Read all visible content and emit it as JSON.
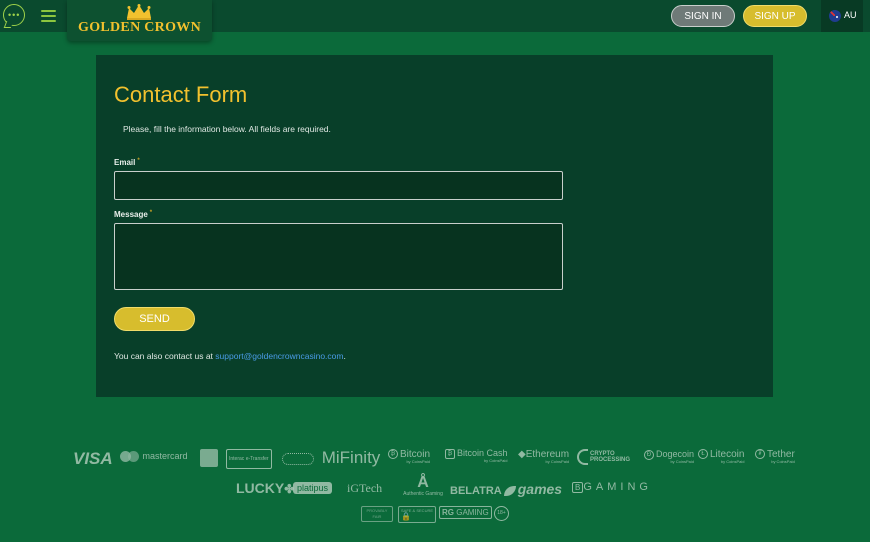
{
  "header": {
    "logo_text": "GOLDEN CROWN",
    "signin_label": "SIGN IN",
    "signup_label": "SIGN UP",
    "language_code": "AU",
    "icons": [
      "chat-icon",
      "menu-icon",
      "crown-icon",
      "au-flag-icon"
    ]
  },
  "form": {
    "title": "Contact Form",
    "intro": "Please, fill the information below. All fields are required.",
    "email_label": "Email",
    "email_value": "",
    "message_label": "Message",
    "message_value": "",
    "required_mark": "*",
    "send_label": "SEND",
    "contact_prefix": "You can also contact us at ",
    "contact_email": "support@goldencrowncasino.com",
    "contact_suffix": "."
  },
  "footer": {
    "payment_logos": {
      "visa": "VISA",
      "mastercard": "mastercard",
      "interac": "Interac",
      "etransfer": "e-Transfer",
      "mifinity": "MiFinity",
      "bitcoin": "Bitcoin",
      "bitcoin_cash": "Bitcoin Cash",
      "ethereum": "Ethereum",
      "crypto_processing": "CRYPTO PROCESSING",
      "dogecoin": "Dogecoin",
      "litecoin": "Litecoin",
      "tether": "Tether",
      "by_coinspaid": "by CoinsPaid",
      "by_coinspaid_short": "by CoinsPaid"
    },
    "provider_logos": {
      "lucky": "LUCKY",
      "platipus": "platipus",
      "igtech": "iGTech",
      "authentic_gaming": "Authentic Gaming",
      "belatra": "BELATRA",
      "games": "games",
      "bgaming": "GAMING"
    },
    "trust_logos": {
      "provably_fair": "PROVABLY FAIR",
      "safe_secure": "SAFE & SECURE",
      "responsible_gaming": "GAMING",
      "age": "18+"
    },
    "colors": {
      "logo_tint": "#a9c7b5"
    }
  },
  "theme": {
    "background": "#0b6a3a",
    "header_bg": "#0a4a2e",
    "panel_bg": "#083f29",
    "accent_gold": "#f2c12e",
    "button_gold": "#d7bd2d",
    "link_blue": "#4a9be6"
  }
}
